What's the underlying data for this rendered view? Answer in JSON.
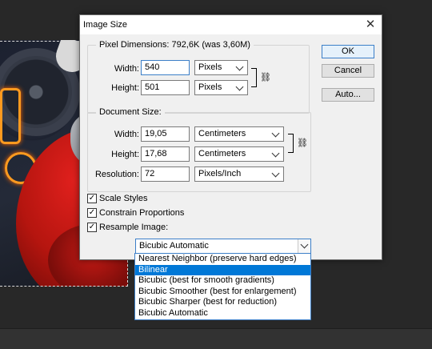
{
  "dialog": {
    "title": "Image Size",
    "pixel_dimensions": {
      "legend": "Pixel Dimensions:  792,6K (was 3,60M)",
      "width_label": "Width:",
      "width_value": "540",
      "width_unit": "Pixels",
      "height_label": "Height:",
      "height_value": "501",
      "height_unit": "Pixels"
    },
    "document_size": {
      "legend": "Document Size:",
      "width_label": "Width:",
      "width_value": "19,05",
      "width_unit": "Centimeters",
      "height_label": "Height:",
      "height_value": "17,68",
      "height_unit": "Centimeters",
      "resolution_label": "Resolution:",
      "resolution_value": "72",
      "resolution_unit": "Pixels/Inch"
    },
    "buttons": {
      "ok": "OK",
      "cancel": "Cancel",
      "auto": "Auto..."
    },
    "options": {
      "scale_styles": "Scale Styles",
      "constrain_proportions": "Constrain Proportions",
      "resample_image": "Resample Image:"
    },
    "resample_value": "Bicubic Automatic",
    "resample_list": [
      "Nearest Neighbor (preserve hard edges)",
      "Bilinear",
      "Bicubic (best for smooth gradients)",
      "Bicubic Smoother (best for enlargement)",
      "Bicubic Sharper (best for reduction)",
      "Bicubic Automatic"
    ],
    "highlighted_item": "Bilinear"
  },
  "icons": {
    "close": "close-icon",
    "link": "chain-link-icon",
    "dropdown": "chevron-down-icon",
    "check": "checkmark-icon"
  },
  "colors": {
    "highlight": "#0078d7",
    "focus_border": "#3c7fc8",
    "workspace": "#282828"
  }
}
